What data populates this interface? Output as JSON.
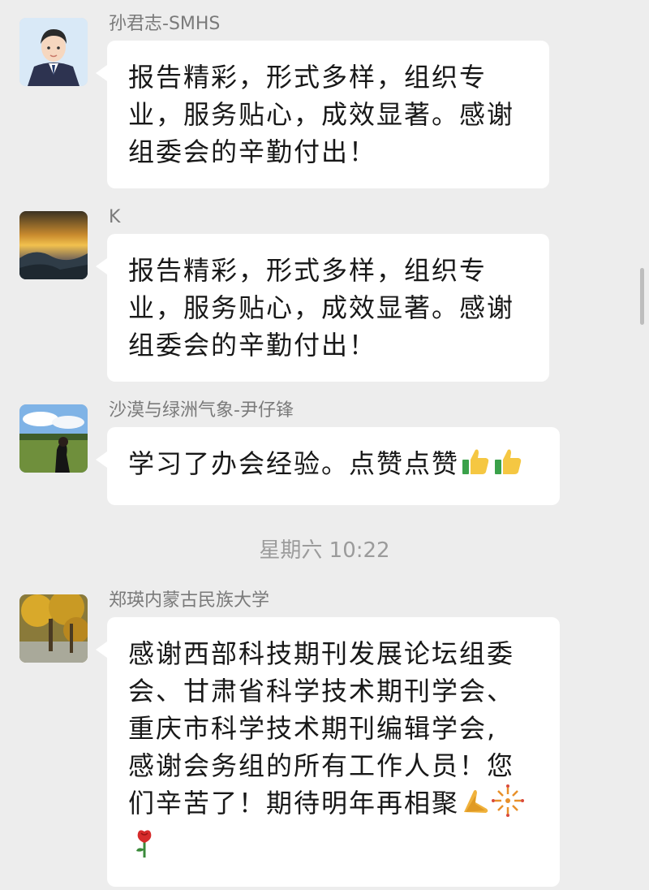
{
  "messages": [
    {
      "sender": "孙君志-SMHS",
      "lines": [
        "报告精彩，形式多样，组织专",
        "业，服务贴心，成效显著。感谢",
        "组委会的辛勤付出！"
      ]
    },
    {
      "sender": "K",
      "lines": [
        "报告精彩，形式多样，组织专",
        "业，服务贴心，成效显著。感谢",
        "组委会的辛勤付出！"
      ]
    },
    {
      "sender": "沙漠与绿洲气象-尹仔锋",
      "lines": [
        "学习了办会经验。点赞点赞"
      ],
      "emojis": [
        "thumbs-up",
        "thumbs-up"
      ]
    },
    {
      "sender": "郑瑛内蒙古民族大学",
      "lines": [
        "感谢西部科技期刊发展论坛组委",
        "会、甘肃省科学技术期刊学会、",
        "重庆市科学技术期刊编辑学会,",
        "感谢会务组的所有工作人员！您",
        "们辛苦了！期待明年再相聚"
      ],
      "emojis": [
        "folded-hands",
        "fireworks",
        "rose"
      ]
    }
  ],
  "timestamp": "星期六 10:22"
}
